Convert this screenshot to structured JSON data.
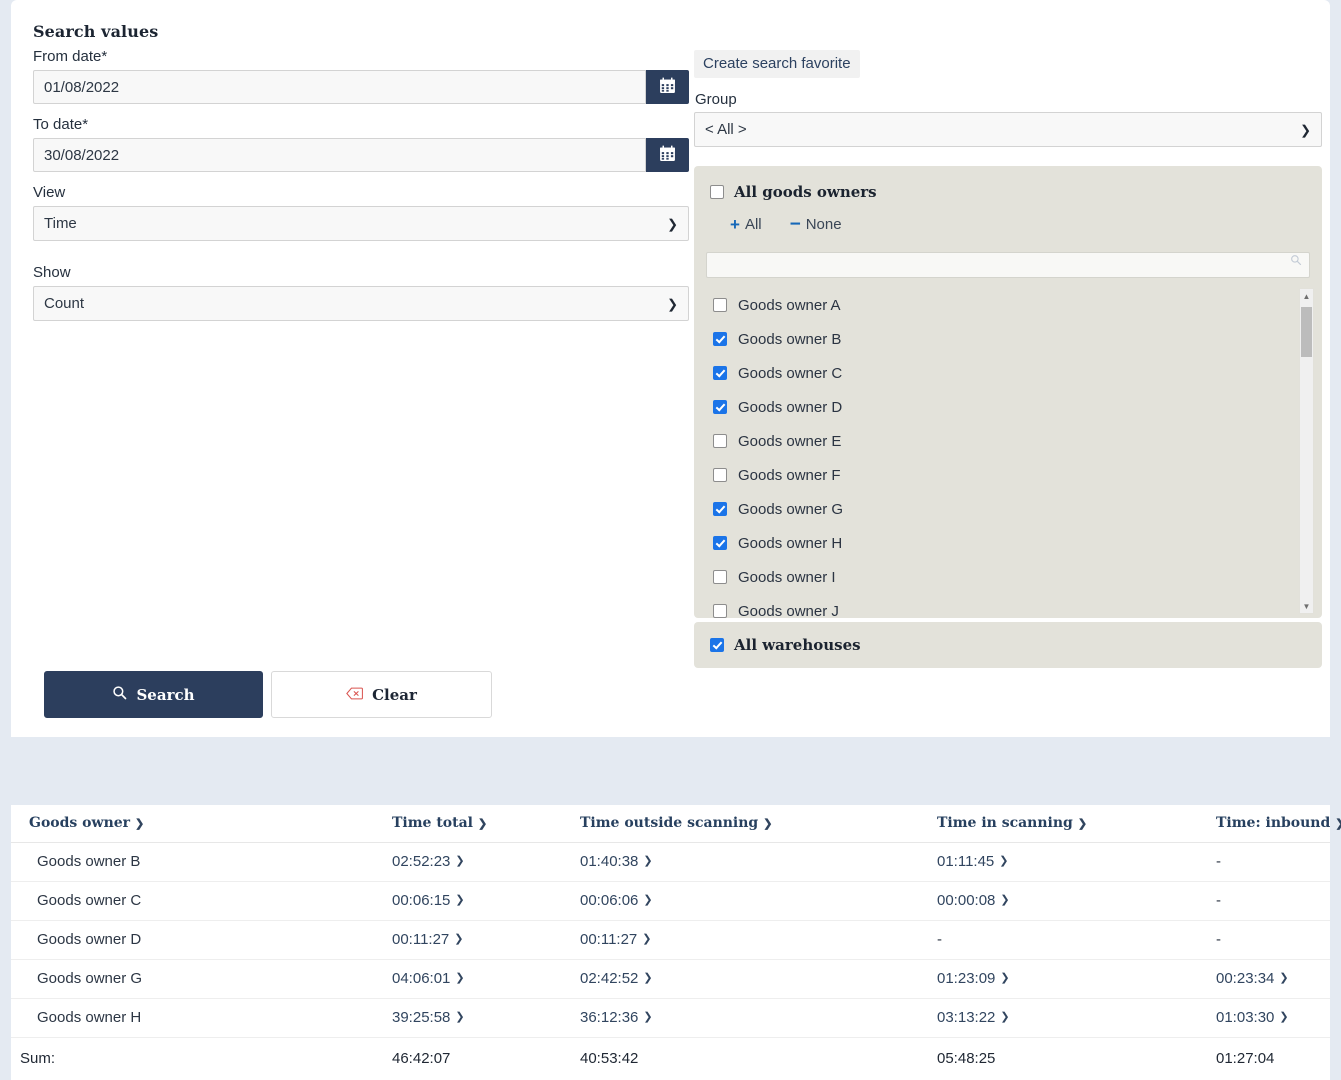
{
  "search_panel": {
    "title": "Search values",
    "from_date": {
      "label": "From date*",
      "value": "01/08/2022",
      "calendar_icon": "calendar-icon"
    },
    "to_date": {
      "label": "To date*",
      "value": "30/08/2022",
      "calendar_icon": "calendar-icon"
    },
    "view": {
      "label": "View",
      "value": "Time"
    },
    "show": {
      "label": "Show",
      "value": "Count"
    },
    "search_button": "Search",
    "clear_button": "Clear",
    "search_icon": "magnifier-icon",
    "clear_icon": "backspace-delete-icon"
  },
  "right_panel": {
    "create_favorite": "Create search favorite",
    "group": {
      "label": "Group",
      "value": "< All >"
    },
    "goods_owners": {
      "all_label": "All goods owners",
      "all_checked": false,
      "select_all": "All",
      "select_none": "None",
      "filter_value": "",
      "filter_placeholder": "",
      "filter_icon": "magnifier-icon",
      "items": [
        {
          "label": "Goods owner A",
          "checked": false
        },
        {
          "label": "Goods owner B",
          "checked": true
        },
        {
          "label": "Goods owner C",
          "checked": true
        },
        {
          "label": "Goods owner D",
          "checked": true
        },
        {
          "label": "Goods owner E",
          "checked": false
        },
        {
          "label": "Goods owner F",
          "checked": false
        },
        {
          "label": "Goods owner G",
          "checked": true
        },
        {
          "label": "Goods owner H",
          "checked": true
        },
        {
          "label": "Goods owner I",
          "checked": false
        },
        {
          "label": "Goods owner J",
          "checked": false
        }
      ]
    },
    "warehouses": {
      "all_label": "All warehouses",
      "all_checked": true
    }
  },
  "results_table": {
    "columns": [
      "Goods owner",
      "Time total",
      "Time outside scanning",
      "Time in scanning",
      "Time: inbound"
    ],
    "rows": [
      {
        "owner": "Goods owner B",
        "time_total": "02:52:23",
        "time_outside_scanning": "01:40:38",
        "time_in_scanning": "01:11:45",
        "time_inbound": "-"
      },
      {
        "owner": "Goods owner C",
        "time_total": "00:06:15",
        "time_outside_scanning": "00:06:06",
        "time_in_scanning": "00:00:08",
        "time_inbound": "-"
      },
      {
        "owner": "Goods owner D",
        "time_total": "00:11:27",
        "time_outside_scanning": "00:11:27",
        "time_in_scanning": "-",
        "time_inbound": "-"
      },
      {
        "owner": "Goods owner G",
        "time_total": "04:06:01",
        "time_outside_scanning": "02:42:52",
        "time_in_scanning": "01:23:09",
        "time_inbound": "00:23:34"
      },
      {
        "owner": "Goods owner H",
        "time_total": "39:25:58",
        "time_outside_scanning": "36:12:36",
        "time_in_scanning": "03:13:22",
        "time_inbound": "01:03:30"
      }
    ],
    "sum": {
      "owner": "Sum:",
      "time_total": "46:42:07",
      "time_outside_scanning": "40:53:42",
      "time_in_scanning": "05:48:25",
      "time_inbound": "01:27:04"
    }
  },
  "colors": {
    "page_background": "#e4eaf2",
    "primary_navy": "#2c3e5d",
    "panel_beige": "#e3e2da",
    "checkbox_blue": "#1b74e8",
    "link_navy": "#31455f",
    "clear_icon_red": "#d9534f"
  }
}
